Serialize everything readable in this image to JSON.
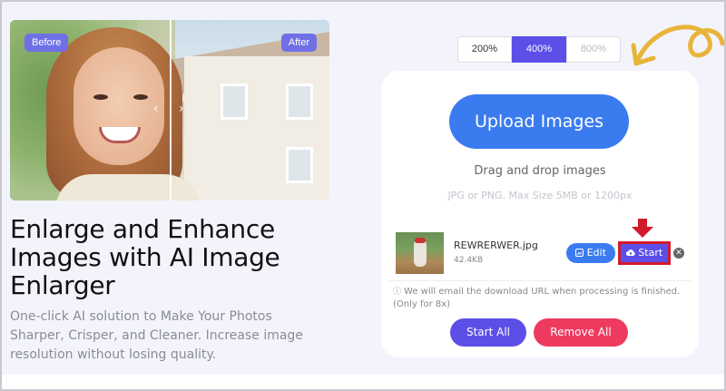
{
  "hero": {
    "before_label": "Before",
    "after_label": "After",
    "left_chevron": "‹",
    "right_chevron": "›"
  },
  "headline": "Enlarge and Enhance Images with AI Image Enlarger",
  "subheadline": "One-click AI solution to Make Your Photos Sharper, Crisper, and Cleaner. Increase image resolution without losing quality.",
  "scale_options": [
    {
      "label": "200%",
      "state": "normal"
    },
    {
      "label": "400%",
      "state": "selected"
    },
    {
      "label": "800%",
      "state": "disabled"
    }
  ],
  "upload": {
    "button_label": "Upload Images",
    "drag_text": "Drag and drop images",
    "limits_text": "JPG or PNG. Max Size 5MB or 1200px"
  },
  "file": {
    "name": "REWRERWER.jpg",
    "size": "42.4KB",
    "edit_label": "Edit",
    "start_label": "Start",
    "edit_icon": "image-edit-icon",
    "start_icon": "cloud-upload-icon",
    "remove_icon": "close-icon"
  },
  "note": "We will email the download URL when processing is finished. (Only for 8x)",
  "actions": {
    "start_all": "Start All",
    "remove_all": "Remove All"
  },
  "colors": {
    "primary_blue": "#3b7bf0",
    "accent_purple": "#5b4fe8",
    "danger_pink": "#ee3a5f",
    "highlight_red": "#d11a2a",
    "doodle_yellow": "#e8b43a"
  }
}
